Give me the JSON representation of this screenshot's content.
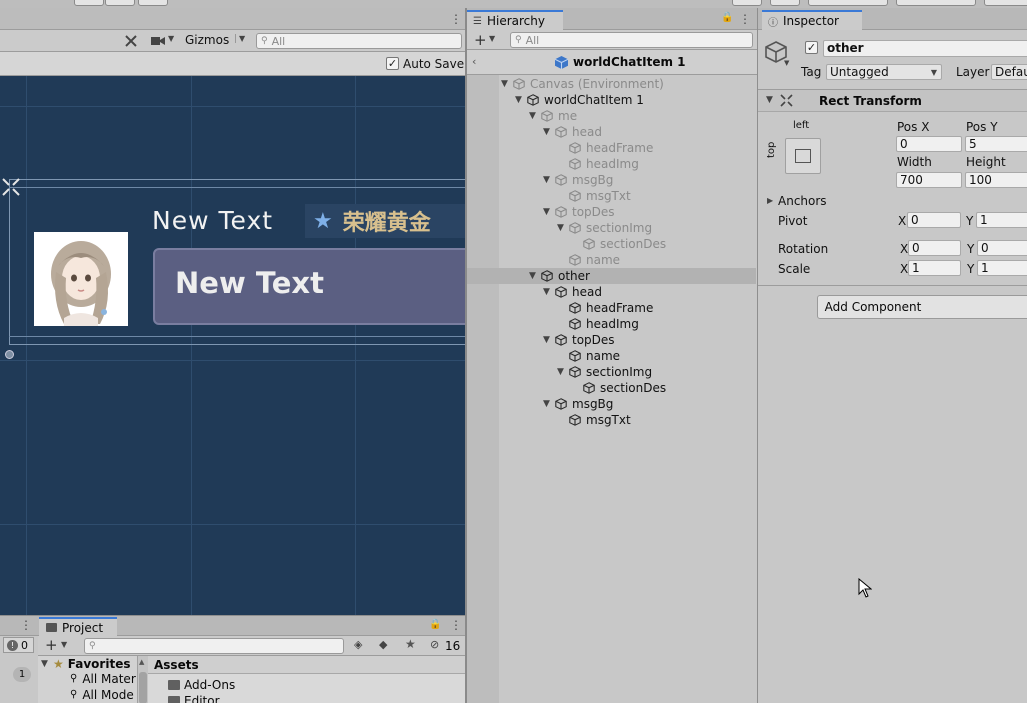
{
  "scene": {
    "gizmos_label": "Gizmos",
    "search_placeholder": "All",
    "auto_save_label": "Auto Save",
    "auto_save_checked": true,
    "canvas_title_text": "New Text",
    "canvas_badge_text": "荣耀黄金",
    "canvas_msg_text": "New Text"
  },
  "hierarchy": {
    "tab_label": "Hierarchy",
    "search_placeholder": "All",
    "prefab_title": "worldChatItem 1",
    "items": [
      {
        "label": "Canvas (Environment)",
        "depth": 0,
        "expanded": true,
        "has_children": true,
        "dim": true,
        "selected": false
      },
      {
        "label": "worldChatItem 1",
        "depth": 1,
        "expanded": true,
        "has_children": true,
        "dim": false,
        "selected": false
      },
      {
        "label": "me",
        "depth": 2,
        "expanded": true,
        "has_children": true,
        "dim": true,
        "selected": false
      },
      {
        "label": "head",
        "depth": 3,
        "expanded": true,
        "has_children": true,
        "dim": true,
        "selected": false
      },
      {
        "label": "headFrame",
        "depth": 4,
        "expanded": false,
        "has_children": false,
        "dim": true,
        "selected": false
      },
      {
        "label": "headImg",
        "depth": 4,
        "expanded": false,
        "has_children": false,
        "dim": true,
        "selected": false
      },
      {
        "label": "msgBg",
        "depth": 3,
        "expanded": true,
        "has_children": true,
        "dim": true,
        "selected": false
      },
      {
        "label": "msgTxt",
        "depth": 4,
        "expanded": false,
        "has_children": false,
        "dim": true,
        "selected": false
      },
      {
        "label": "topDes",
        "depth": 3,
        "expanded": true,
        "has_children": true,
        "dim": true,
        "selected": false
      },
      {
        "label": "sectionImg",
        "depth": 4,
        "expanded": true,
        "has_children": true,
        "dim": true,
        "selected": false
      },
      {
        "label": "sectionDes",
        "depth": 5,
        "expanded": false,
        "has_children": false,
        "dim": true,
        "selected": false
      },
      {
        "label": "name",
        "depth": 4,
        "expanded": false,
        "has_children": false,
        "dim": true,
        "selected": false
      },
      {
        "label": "other",
        "depth": 2,
        "expanded": true,
        "has_children": true,
        "dim": false,
        "selected": true
      },
      {
        "label": "head",
        "depth": 3,
        "expanded": true,
        "has_children": true,
        "dim": false,
        "selected": false
      },
      {
        "label": "headFrame",
        "depth": 4,
        "expanded": false,
        "has_children": false,
        "dim": false,
        "selected": false
      },
      {
        "label": "headImg",
        "depth": 4,
        "expanded": false,
        "has_children": false,
        "dim": false,
        "selected": false
      },
      {
        "label": "topDes",
        "depth": 3,
        "expanded": true,
        "has_children": true,
        "dim": false,
        "selected": false
      },
      {
        "label": "name",
        "depth": 4,
        "expanded": false,
        "has_children": false,
        "dim": false,
        "selected": false
      },
      {
        "label": "sectionImg",
        "depth": 4,
        "expanded": true,
        "has_children": true,
        "dim": false,
        "selected": false
      },
      {
        "label": "sectionDes",
        "depth": 5,
        "expanded": false,
        "has_children": false,
        "dim": false,
        "selected": false
      },
      {
        "label": "msgBg",
        "depth": 3,
        "expanded": true,
        "has_children": true,
        "dim": false,
        "selected": false
      },
      {
        "label": "msgTxt",
        "depth": 4,
        "expanded": false,
        "has_children": false,
        "dim": false,
        "selected": false
      }
    ]
  },
  "inspector": {
    "tab_label": "Inspector",
    "object_name": "other",
    "active_checked": true,
    "tag_label": "Tag",
    "tag_value": "Untagged",
    "layer_label": "Layer",
    "layer_value": "Defau",
    "rect_transform_title": "Rect Transform",
    "anchor_h_label": "left",
    "anchor_v_label": "top",
    "pos_x_label": "Pos X",
    "pos_y_label": "Pos Y",
    "pos_x": "0",
    "pos_y": "5",
    "width_label": "Width",
    "height_label": "Height",
    "width": "700",
    "height": "100",
    "anchors_label": "Anchors",
    "pivot_label": "Pivot",
    "pivot_x": "0",
    "pivot_y": "1",
    "rotation_label": "Rotation",
    "rotation_x": "0",
    "rotation_y": "0",
    "scale_label": "Scale",
    "scale_x": "1",
    "scale_y": "1",
    "x_label": "X",
    "y_label": "Y",
    "add_component_label": "Add Component"
  },
  "project": {
    "tab_label": "Project",
    "console_count": "0",
    "hidden_count": "16",
    "favorites_label": "Favorites",
    "favorites": [
      "All Mater",
      "All Mode"
    ],
    "assets_label": "Assets",
    "asset_folders": [
      "Add-Ons",
      "Editor"
    ],
    "side_badge": "1"
  },
  "colors": {
    "scene_bg": "#203a57",
    "panel_bg": "#c8c8c8",
    "selected_row": "#b2b2b2",
    "msg_box": "#5b5f82"
  }
}
